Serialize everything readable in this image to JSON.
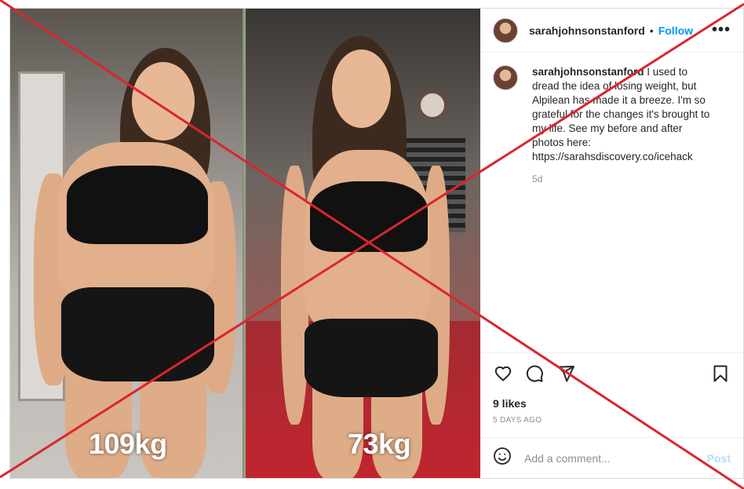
{
  "post": {
    "username": "sarahjohnsonstanford",
    "follow_label": "Follow",
    "separator": "•",
    "more_label": "•••",
    "caption": "I used to dread the idea of losing weight, but Alpilean has made it a breeze. I'm so grateful for the changes it's brought to my life. See my before and after photos here: https://sarahsdiscovery.co/icehack",
    "caption_age": "5d",
    "likes": "9 likes",
    "posted_ago": "5 DAYS AGO",
    "comment_placeholder": "Add a comment...",
    "post_label": "Post"
  },
  "image": {
    "before_label": "109kg",
    "after_label": "73kg"
  },
  "icons": {
    "like": "heart-icon",
    "comment": "comment-icon",
    "share": "share-icon",
    "save": "bookmark-icon",
    "emoji": "emoji-icon",
    "more": "more-icon"
  },
  "colors": {
    "follow": "#0095f6",
    "post_disabled": "#b2dffc",
    "x_overlay": "#d9262e"
  }
}
